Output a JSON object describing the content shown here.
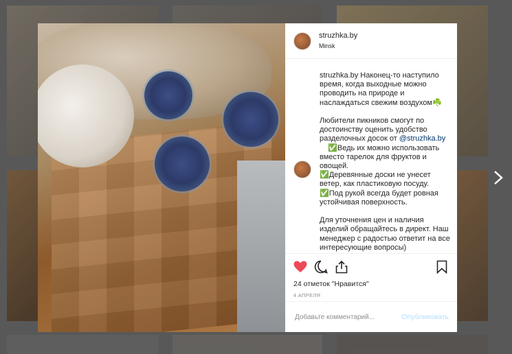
{
  "post": {
    "username": "struzhka.by",
    "location": "Minsk",
    "caption_user": "struzhka.by",
    "caption_part1": " Наконец-то наступило время, когда выходные можно проводить на природе и наслаждаться свежим воздухом☘️\n\nЛюбители пикников смогут по достоинству оценить удобство разделочных досок от ",
    "mention": "@struzhka.by",
    "caption_part2": "\n    ✅Ведь их можно использовать вместо тарелок для фруктов и овощей.\n✅Деревянные доски не унесет ветер, как пластиковую посуду.\n✅Под рукой всегда будет ровная устойчивая поверхность.\n\nДля уточнения цен и наличия изделий обращайтесь в директ. Наш менеджер с радостью ответит на все интересующие вопросы)",
    "likes": "24 отметок \"Нравится\"",
    "date": "4 апреля"
  },
  "comment_box": {
    "placeholder": "Добавьте комментарий...",
    "publish_label": "Опубликовать"
  },
  "icons": {
    "like": "heart-icon",
    "comment": "comment-icon",
    "share": "share-icon",
    "save": "bookmark-icon",
    "next": "chevron-right-icon"
  },
  "colors": {
    "like_red": "#ed4956",
    "mention_blue": "#00376b",
    "publish_disabled": "#b2dffc"
  }
}
